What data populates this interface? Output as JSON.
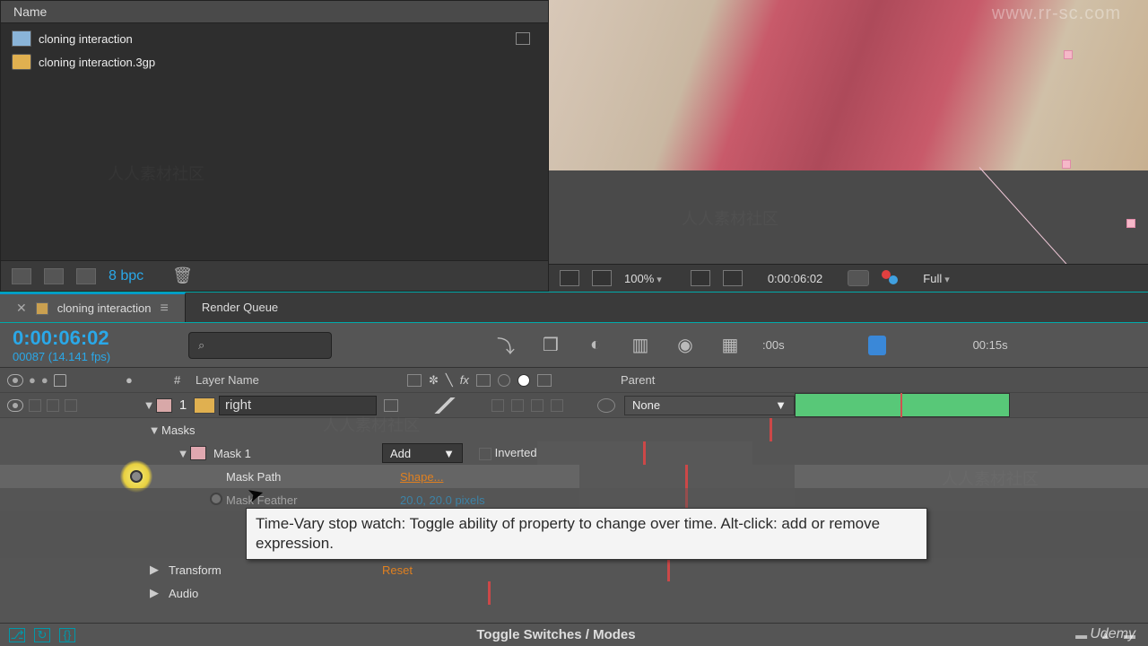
{
  "project": {
    "headerName": "Name",
    "items": [
      {
        "type": "comp",
        "label": "cloning interaction"
      },
      {
        "type": "video",
        "label": "cloning interaction.3gp"
      }
    ],
    "bpc": "8 bpc"
  },
  "preview": {
    "zoom": "100%",
    "timecode": "0:00:06:02",
    "resolution": "Full"
  },
  "tabs": {
    "activeComp": "cloning interaction",
    "renderQueue": "Render Queue"
  },
  "timeline": {
    "timecode": "0:00:06:02",
    "subline": "00087 (14.141 fps)",
    "searchIcon": "⌕",
    "rulerMarks": [
      ":00s",
      "00:15s"
    ],
    "columns": {
      "shy": "●",
      "num": "#",
      "layerName": "Layer Name",
      "parent": "Parent"
    },
    "toggleLabel": "Toggle Switches / Modes"
  },
  "layer": {
    "num": "1",
    "name": "right",
    "parentNone": "None",
    "groups": {
      "masks": "Masks",
      "mask1": "Mask 1",
      "maskMode": "Add",
      "inverted": "Inverted",
      "maskPath": "Mask Path",
      "maskPathVal": "Shape...",
      "maskFeather": "Mask Feather",
      "maskFeatherVal": "20.0, 20.0 pixels",
      "transform": "Transform",
      "transformVal": "Reset",
      "audio": "Audio"
    }
  },
  "tooltip": "Time-Vary stop watch: Toggle ability of property to change over time. Alt-click: add or remove expression.",
  "watermarks": {
    "topRight": "www.rr-sc.com",
    "bottomRight": "Udemy",
    "faint": "人人素材社区"
  }
}
